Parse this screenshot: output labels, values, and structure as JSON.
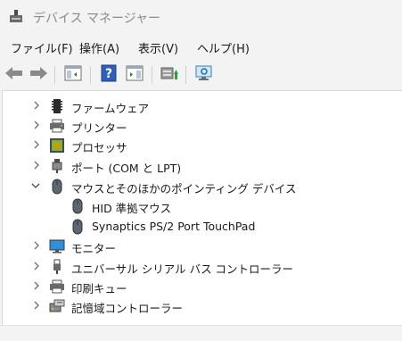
{
  "window": {
    "title": "デバイス マネージャー"
  },
  "menubar": {
    "items": [
      "ファイル(F)",
      "操作(A)",
      "表示(V)",
      "ヘルプ(H)"
    ]
  },
  "toolbar": {
    "buttons": [
      {
        "icon": "back-arrow-icon"
      },
      {
        "icon": "forward-arrow-icon"
      },
      {
        "icon": "console-tree-icon"
      },
      {
        "icon": "help-icon"
      },
      {
        "icon": "action-pane-icon"
      },
      {
        "icon": "update-driver-icon"
      },
      {
        "icon": "scan-hardware-icon"
      }
    ]
  },
  "tree": {
    "nodes": [
      {
        "label": "ファームウェア",
        "icon": "firmware-icon",
        "expanded": false,
        "level": 0
      },
      {
        "label": "プリンター",
        "icon": "printer-icon",
        "expanded": false,
        "level": 0
      },
      {
        "label": "プロセッサ",
        "icon": "processor-icon",
        "expanded": false,
        "level": 0
      },
      {
        "label": "ポート (COM と LPT)",
        "icon": "port-icon",
        "expanded": false,
        "level": 0
      },
      {
        "label": "マウスとそのほかのポインティング デバイス",
        "icon": "mouse-icon",
        "expanded": true,
        "level": 0
      },
      {
        "label": "HID 準拠マウス",
        "icon": "mouse-icon",
        "level": 1
      },
      {
        "label": "Synaptics PS/2 Port TouchPad",
        "icon": "mouse-icon",
        "level": 1
      },
      {
        "label": "モニター",
        "icon": "monitor-icon",
        "expanded": false,
        "level": 0
      },
      {
        "label": "ユニバーサル シリアル バス コントローラー",
        "icon": "usb-icon",
        "expanded": false,
        "level": 0
      },
      {
        "label": "印刷キュー",
        "icon": "print-queue-icon",
        "expanded": false,
        "level": 0
      },
      {
        "label": "記憶域コントローラー",
        "icon": "storage-controller-icon",
        "expanded": false,
        "level": 0
      }
    ]
  }
}
